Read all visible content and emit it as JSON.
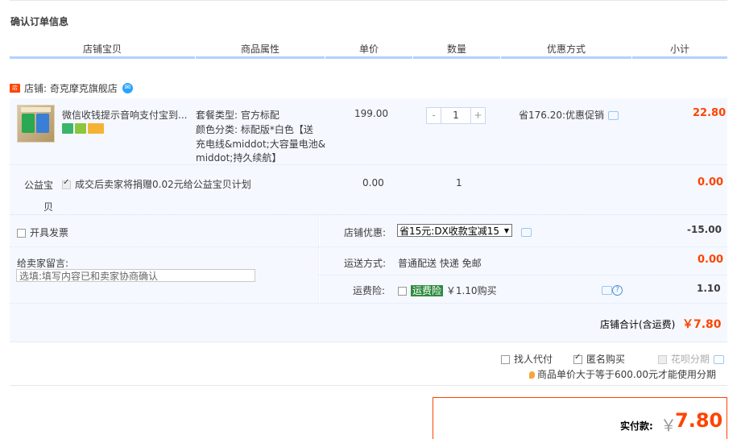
{
  "title": "确认订单信息",
  "headers": [
    "店铺宝贝",
    "商品属性",
    "单价",
    "数量",
    "优惠方式",
    "小计"
  ],
  "shop": {
    "label": "店铺: 奇克摩克旗舰店"
  },
  "item": {
    "name": "微信收钱提示音响支付宝到...",
    "attr_lines": [
      "套餐类型: 官方标配",
      "颜色分类: 标配版*白色【送",
      "充电线&middot;大容量电池&",
      "middot;持久续航】"
    ],
    "price": "199.00",
    "qty": "1",
    "minus": "-",
    "plus": "+",
    "discount": "省176.20:优惠促销",
    "subtotal": "22.80"
  },
  "charity": {
    "label_1": "公益宝",
    "label_2": "贝",
    "text": "成交后卖家将捐赠0.02元给公益宝贝计划",
    "price": "0.00",
    "qty": "1",
    "subtotal": "0.00"
  },
  "invoice_label": "开具发票",
  "shop_discount": {
    "label": "店铺优惠:",
    "selected": "省15元:DX收款宝减15",
    "amount": "-15.00"
  },
  "message": {
    "label": "给卖家留言:",
    "placeholder": "选填:填写内容已和卖家协商确认"
  },
  "shipping": {
    "label": "运送方式:",
    "value": "普通配送 快递 免邮",
    "amount": "0.00"
  },
  "freight_insurance": {
    "label": "运费险:",
    "tag": "运费险",
    "price": "￥1.10购买",
    "amount": "1.10"
  },
  "shop_total": {
    "label": "店铺合计(含运费)",
    "amount": "￥7.80"
  },
  "options": {
    "proxy_pay": "找人代付",
    "anonymous": "匿名购买",
    "huabei": "花呗分期",
    "huabei_note": "商品单价大于等于600.00元才能使用分期"
  },
  "actual": {
    "label": "实付款:",
    "currency": "￥",
    "amount": "7.80"
  },
  "colors": {
    "accent": "#ff4400",
    "header_line": "#b2d1ff",
    "row_bg": "#f5f8ff"
  }
}
